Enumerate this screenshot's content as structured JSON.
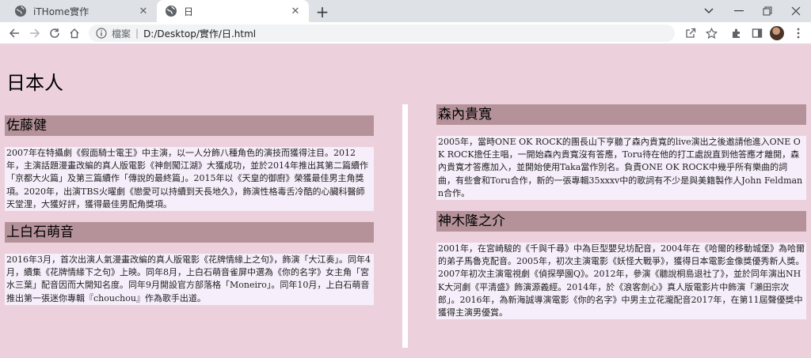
{
  "browser": {
    "tabs": [
      {
        "title": "iTHome實作",
        "active": false
      },
      {
        "title": "日",
        "active": true
      }
    ],
    "address": {
      "site_label": "檔案",
      "divider": "|",
      "url": "D:/Desktop/實作/日.html"
    }
  },
  "page": {
    "title": "日本人",
    "left_column": [
      {
        "name": "佐藤健",
        "bio": "2007年在特攝劇《假面騎士電王》中主演，以一人分飾八種角色的演技而獲得注目。2012年，主演話題漫畫改編的真人版電影《神劍闖江湖》大獲成功，並於2014年推出其第二篇續作「京都大火篇」及第三篇續作「傳說的最終篇」。2015年以《天皇的御廚》榮獲最佳男主角獎項。2020年，出演TBS火曜劇《戀愛可以持續到天長地久》，飾演性格毒舌冷酷的心臟科醫師天堂浬，大獲好評，獲得最佳男配角獎項。"
      },
      {
        "name": "上白石萌音",
        "bio": "2016年3月，首次出演人氣漫畫改編的真人版電影《花牌情緣上之句》，飾演「大江奏」。同年4月，續集《花牌情緣下之句》上映。同年8月，上白石萌音雀屏中選為《你的名字》女主角「宮水三葉」配音因而大開知名度。同年9月開設官方部落格「Moneiro」。同年10月，上白石萌音推出第一張迷你專輯『chouchou』作為歌手出道。"
      }
    ],
    "right_column": [
      {
        "name": "森內貴寬",
        "bio": "2005年，當時ONE OK ROCK的團長山下亨聽了森內貴寬的live演出之後邀請他進入ONE OK ROCK擔任主唱，一開始森內貴寬沒有答應，Toru待在他的打工處說直到他答應才離開，森內貴寬才答應加入，並開始使用Taka當作別名。負責ONE OK ROCK中幾乎所有樂曲的詞曲，有些會和Toru合作，新的一張專輯35xxxv中的歌詞有不少是與美籍製作人John Feldmann合作。"
      },
      {
        "name": "神木隆之介",
        "bio": "2001年，在宮崎駿的《千與千尋》中為巨型嬰兒坊配音，2004年在《哈爾的移動城堡》為哈爾的弟子馬魯克配音。2005年，初次主演電影《妖怪大戰爭》，獲得日本電影金像獎優秀新人獎。 2007年初次主演電視劇《偵探學園Q》。2012年，參演《聽說桐島退社了》，並於同年演出NHK大河劇《平清盛》飾演源義經。2014年，於《浪客劍心》真人版電影片中飾演「瀨田宗次郎」。2016年，為新海誠導演電影《你的名字》中男主立花瀧配音2017年，在第11屆聲優獎中獲得主演男優賞。"
      }
    ]
  }
}
